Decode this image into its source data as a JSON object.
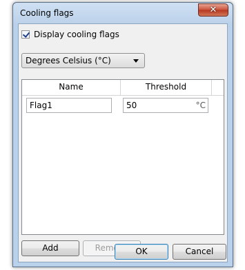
{
  "window": {
    "title": "Cooling flags",
    "close_icon": "✕"
  },
  "options": {
    "display_label": "Display cooling flags",
    "display_checked": true
  },
  "unit_select": {
    "selected": "Degrees Celsius (°C)"
  },
  "table": {
    "columns": [
      "Name",
      "Threshold"
    ],
    "rows": [
      {
        "name": "Flag1",
        "threshold": "50",
        "unit": "°C"
      }
    ]
  },
  "buttons": {
    "add": "Add",
    "remove": "Remove",
    "ok": "OK",
    "cancel": "Cancel"
  }
}
